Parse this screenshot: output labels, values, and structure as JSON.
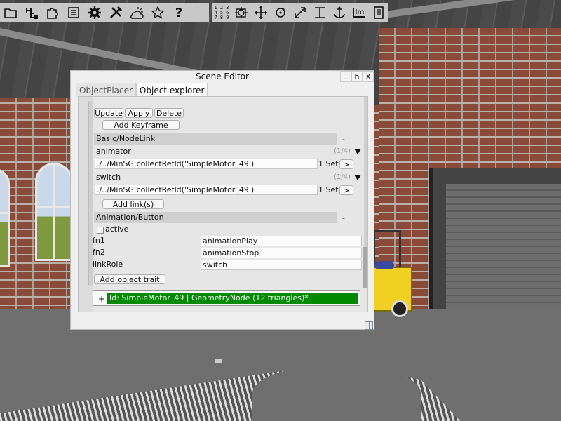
{
  "toolbar_left": {
    "icons": [
      "folder-icon",
      "tree-add-icon",
      "puzzle-icon",
      "list-icon",
      "gear-icon",
      "tools-icon",
      "weather-icon",
      "star-icon",
      "help-icon"
    ],
    "help_label": "?"
  },
  "toolbar_right": {
    "icons": [
      "numbers-grid-icon",
      "camera-target-icon",
      "move-icon",
      "rotate-icon",
      "scale-icon",
      "align-icon",
      "anchor-icon",
      "measure-icon",
      "notes-icon"
    ],
    "numbers_label": "1 2 3\n4 5 6\n7 8 9",
    "measure_label": "Im"
  },
  "editor": {
    "title": "Scene Editor",
    "controls": {
      "minimize": ".",
      "hide": "h",
      "close": "X"
    },
    "tabs": [
      {
        "label": "ObjectPlacer",
        "active": false
      },
      {
        "label": "Object explorer",
        "active": true
      }
    ],
    "buttons": {
      "update": "Update",
      "apply": "Apply",
      "delete": "Delete",
      "add_keyframe": "Add Keyframe",
      "add_links": "Add link(s)",
      "add_object_trait": "Add object trait"
    },
    "sections": [
      {
        "title": "Basic/NodeLink",
        "collapse": "-"
      },
      {
        "title": "Animation/Button",
        "collapse": "-"
      }
    ],
    "links": [
      {
        "name": "animator",
        "count": "(1/4)",
        "value": "./../MinSG:collectRefId('SimpleMotor_49')",
        "set": "1 Set",
        "go": ">"
      },
      {
        "name": "switch",
        "count": "(1/4)",
        "value": "./../MinSG:collectRefId('SimpleMotor_49')",
        "set": "1 Set",
        "go": ">"
      }
    ],
    "active_label": "active",
    "active_checked": false,
    "props": [
      {
        "key": "fn1",
        "value": "animationPlay"
      },
      {
        "key": "fn2",
        "value": "animationStop"
      },
      {
        "key": "linkRole",
        "value": "switch"
      }
    ],
    "node": {
      "expand": "+",
      "label": "Id: SimpleMotor_49 | GeometryNode (12 triangles)*"
    }
  },
  "colors": {
    "node_highlight": "#008a00",
    "toolbar_bg": "#c8c8c8",
    "window_bg": "#efefef"
  }
}
